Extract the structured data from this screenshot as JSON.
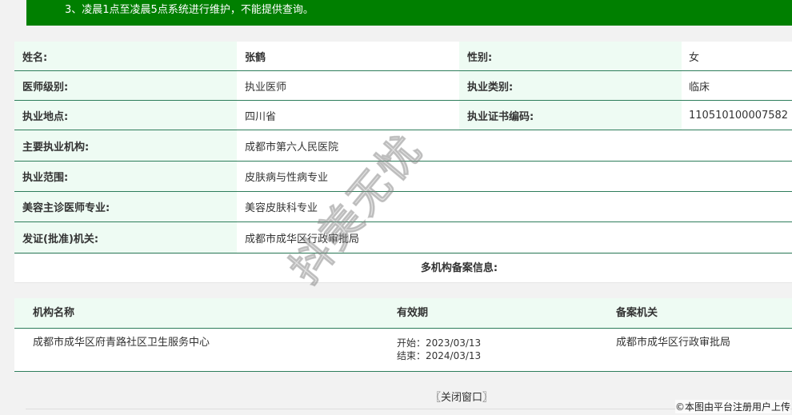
{
  "notice": {
    "line3": "3、凌晨1点至凌晨5点系统进行维护，不能提供查询。"
  },
  "info": {
    "name_label": "姓名:",
    "name_value": "张鹤",
    "gender_label": "性别:",
    "gender_value": "女",
    "level_label": "医师级别:",
    "level_value": "执业医师",
    "category_label": "执业类别:",
    "category_value": "临床",
    "place_label": "执业地点:",
    "place_value": "四川省",
    "cert_label": "执业证书编码:",
    "cert_value": "110510100007582",
    "org_label": "主要执业机构:",
    "org_value": "成都市第六人民医院",
    "scope_label": "执业范围:",
    "scope_value": "皮肤病与性病专业",
    "cosmetic_label": "美容主诊医师专业:",
    "cosmetic_value": "美容皮肤科专业",
    "issuer_label": "发证(批准)机关:",
    "issuer_value": "成都市成华区行政审批局"
  },
  "multi": {
    "title": "多机构备案信息:",
    "headers": {
      "org": "机构名称",
      "validity": "有效期",
      "authority": "备案机关"
    },
    "rows": [
      {
        "org": "成都市成华区府青路社区卫生服务中心",
        "start": "开始：2023/03/13",
        "end": "结束：2024/03/13",
        "authority": "成都市成华区行政审批局"
      }
    ]
  },
  "close_label": "〖关闭窗口〗",
  "watermark": "抖美无忧",
  "footnote": "©本图由平台注册用户上传"
}
